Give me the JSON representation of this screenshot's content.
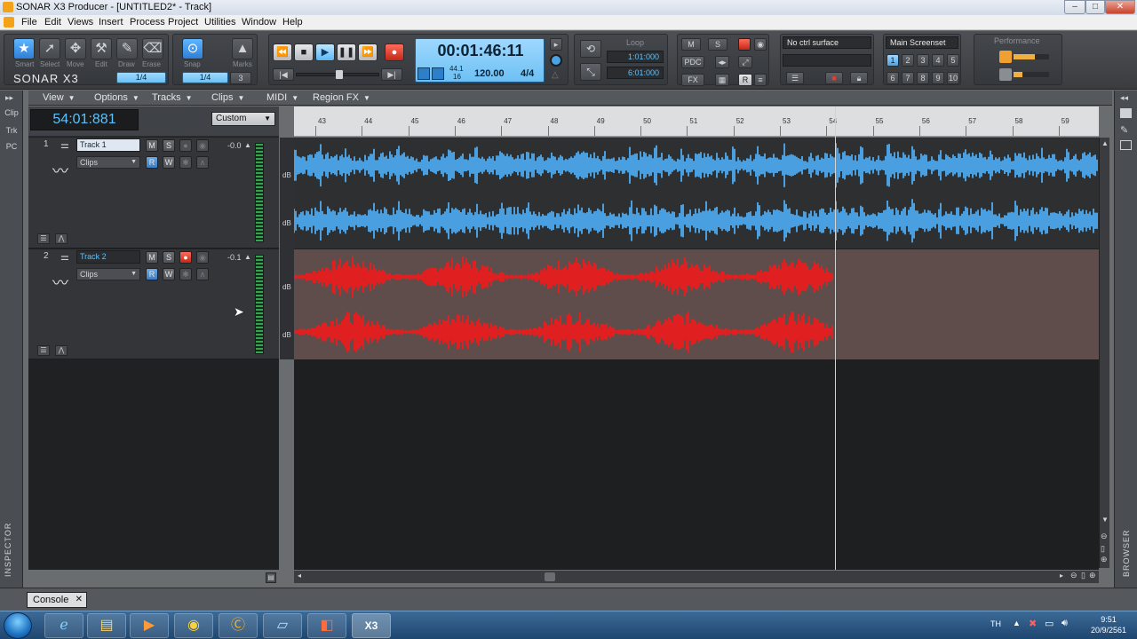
{
  "window": {
    "title": "SONAR X3 Producer - [UNTITLED2* - Track]",
    "buttons": [
      "–",
      "□",
      "✕"
    ]
  },
  "menubar": [
    "File",
    "Edit",
    "Views",
    "Insert",
    "Process",
    "Project",
    "Utilities",
    "Window",
    "Help"
  ],
  "control_bar": {
    "tools": [
      "Smart",
      "Select",
      "Move",
      "Edit",
      "Draw",
      "Erase"
    ],
    "snap_label": "Snap",
    "marks_label": "Marks",
    "snap_value": "1/4",
    "snap_value2": "1/4",
    "snap_count": "3",
    "logo": "SONAR X3",
    "transport_time": "00:01:46:11",
    "sample_rate": "44.1",
    "bit_depth": "16",
    "tempo": "120.00",
    "meter": "4/4",
    "loop_label": "Loop",
    "loop_start": "1:01:000",
    "loop_end": "6:01:000",
    "mix_buttons": [
      "M",
      "S",
      "PDC",
      "FX"
    ],
    "ctrl_surface": "No ctrl surface",
    "screenset_label": "Main Screenset",
    "screensets_top": [
      "1",
      "2",
      "3",
      "4",
      "5"
    ],
    "screensets_bottom": [
      "6",
      "7",
      "8",
      "9",
      "10"
    ],
    "performance_label": "Performance"
  },
  "left_strip": {
    "tabs": [
      "Clip",
      "Trk",
      "PC"
    ],
    "inspector": "INSPECTOR"
  },
  "track_view_menu": [
    "View",
    "Options",
    "Tracks",
    "Clips",
    "MIDI",
    "Region FX"
  ],
  "now_time": "54:01:881",
  "time_format": "Custom",
  "ruler_ticks": [
    "43",
    "44",
    "45",
    "46",
    "47",
    "48",
    "49",
    "50",
    "51",
    "52",
    "53",
    "54",
    "55",
    "56",
    "57",
    "58",
    "59"
  ],
  "tracks": [
    {
      "number": "1",
      "name": "Track 1",
      "clips": "Clips",
      "volume": "-0.0",
      "color": "#4a9fe0",
      "armed": false
    },
    {
      "number": "2",
      "name": "Track 2",
      "clips": "Clips",
      "volume": "-0.1",
      "color": "#e02020",
      "armed": true
    }
  ],
  "track_buttons": {
    "mute": "M",
    "solo": "S",
    "read": "R",
    "write": "W"
  },
  "db_label": "dB",
  "right_strip": {
    "browser": "BROWSER"
  },
  "console_tab": "Console",
  "taskbar": {
    "apps": [
      "IE",
      "Explorer",
      "Media",
      "Chrome",
      "CCleaner",
      "Window",
      "Office",
      "X3"
    ],
    "lang": "TH",
    "time": "9:51",
    "date": "20/9/2561"
  }
}
